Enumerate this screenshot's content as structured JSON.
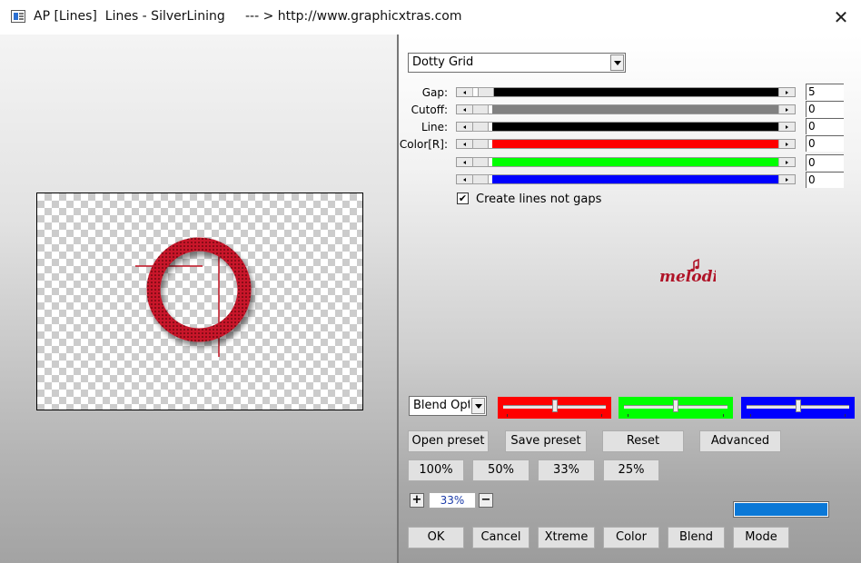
{
  "window": {
    "title": "AP [Lines]  Lines - SilverLining     --- > http://www.graphicxtras.com",
    "close_glyph": "✕"
  },
  "effect": {
    "selected": "Dotty Grid"
  },
  "sliders": [
    {
      "label": "Gap:",
      "value": "5",
      "color": "#000000",
      "position": 0.02
    },
    {
      "label": "Cutoff:",
      "value": "0",
      "color": "#808080",
      "position": 0.0
    },
    {
      "label": "Line:",
      "value": "0",
      "color": "#000000",
      "position": 0.0
    },
    {
      "label": "Color[R]:",
      "value": "0",
      "color": "#ff0000",
      "position": 0.0
    },
    {
      "label": "",
      "value": "0",
      "color": "#00ff00",
      "position": 0.0
    },
    {
      "label": "",
      "value": "0",
      "color": "#0000ff",
      "position": 0.0
    }
  ],
  "checkbox": {
    "label": "Create lines not gaps",
    "checked": true,
    "glyph": "✔"
  },
  "logo_text": "melodi",
  "blend": {
    "selected": "Blend Optio",
    "sliders": [
      {
        "color": "#ff0000",
        "position": 0.5
      },
      {
        "color": "#00ff00",
        "position": 0.5
      },
      {
        "color": "#0000ff",
        "position": 0.5
      }
    ]
  },
  "preset_buttons": [
    "Open preset",
    "Save preset",
    "Reset",
    "Advanced"
  ],
  "zoom_buttons": [
    "100%",
    "50%",
    "33%",
    "25%"
  ],
  "zoom": {
    "value": "33%",
    "plus": "+",
    "minus": "−"
  },
  "progress": {
    "fraction": 0.98,
    "color": "#0a78d7"
  },
  "bottom_buttons": [
    "OK",
    "Cancel",
    "Xtreme",
    "Color",
    "Blend",
    "Mode"
  ]
}
